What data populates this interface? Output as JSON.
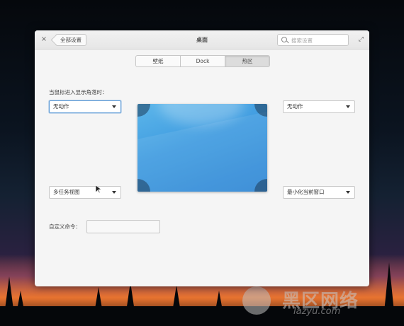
{
  "window": {
    "title": "桌面",
    "back_label": "全部设置",
    "close_icon": "×",
    "expand_icon": "⤢",
    "search_placeholder": "搜索设置"
  },
  "tabs": [
    {
      "label": "壁纸",
      "active": false
    },
    {
      "label": "Dock",
      "active": false
    },
    {
      "label": "热区",
      "active": true
    }
  ],
  "hotcorners": {
    "hint": "当鼠标进入显示角落时：",
    "top_left": "无动作",
    "top_right": "无动作",
    "bottom_left": "多任务视图",
    "bottom_right": "最小化当前窗口"
  },
  "custom_command": {
    "label": "自定义命令：",
    "value": ""
  },
  "watermark": {
    "text": "黑区网络",
    "sub": "lazyu.com"
  },
  "colors": {
    "accent": "#5e9bd6",
    "preview_top": "#5cb6ea",
    "preview_bottom": "#2f86d4"
  }
}
